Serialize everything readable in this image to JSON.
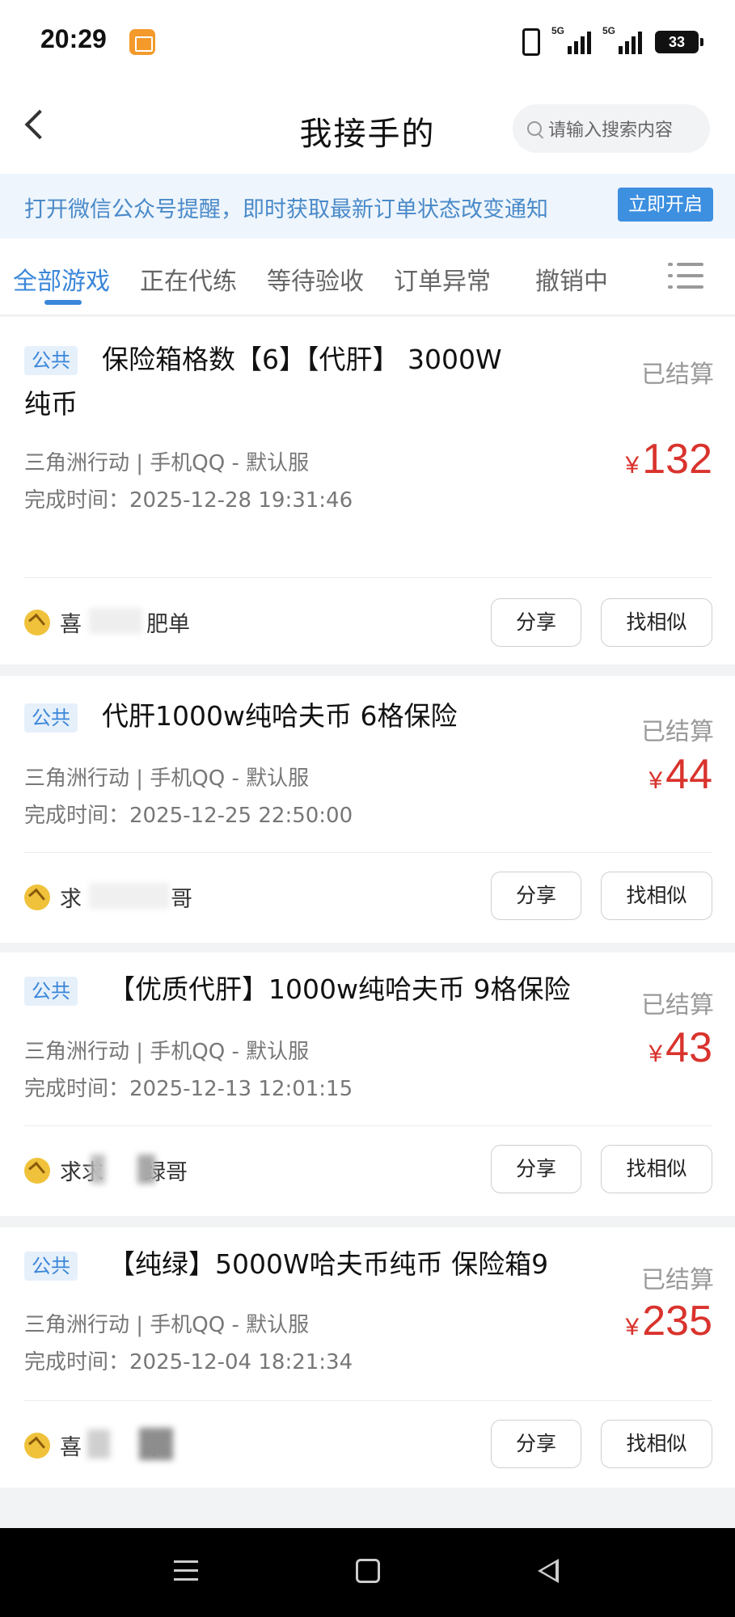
{
  "status_bar": {
    "time": "20:29",
    "network_1": "5G",
    "network_2": "5G",
    "battery": "33"
  },
  "header": {
    "title": "我接手的",
    "search_placeholder": "请输入搜索内容"
  },
  "notice": {
    "text": "打开微信公众号提醒，即时获取最新订单状态改变通知",
    "button": "立即开启"
  },
  "tabs": [
    {
      "label": "全部游戏",
      "active": true
    },
    {
      "label": "正在代练",
      "active": false
    },
    {
      "label": "等待验收",
      "active": false
    },
    {
      "label": "订单异常",
      "active": false
    },
    {
      "label": "撤销中",
      "active": false
    }
  ],
  "orders": [
    {
      "badge": "公共",
      "title_line1": "保险箱格数【6】【代肝】 3000W",
      "title_line2": "纯币",
      "status": "已结算",
      "game_info": "三角洲行动 | 手机QQ - 默认服",
      "finish_time": "完成时间：2025-12-28 19:31:46",
      "currency": "¥",
      "price": "132",
      "seller_start": "喜",
      "seller_end": "肥单",
      "share": "分享",
      "similar": "找相似"
    },
    {
      "badge": "公共",
      "title_line1": "代肝1000w纯哈夫币 6格保险",
      "status": "已结算",
      "game_info": "三角洲行动 | 手机QQ - 默认服",
      "finish_time": "完成时间：2025-12-25 22:50:00",
      "currency": "¥",
      "price": "44",
      "seller_start": "求",
      "seller_end": "哥",
      "share": "分享",
      "similar": "找相似"
    },
    {
      "badge": "公共",
      "title_line1": "【优质代肝】1000w纯哈夫币 9格保险",
      "status": "已结算",
      "game_info": "三角洲行动 | 手机QQ - 默认服",
      "finish_time": "完成时间：2025-12-13 12:01:15",
      "currency": "¥",
      "price": "43",
      "seller_start": "求求",
      "seller_end": "绿哥",
      "share": "分享",
      "similar": "找相似"
    },
    {
      "badge": "公共",
      "title_line1": "【纯绿】5000W哈夫币纯币 保险箱9",
      "status": "已结算",
      "game_info": "三角洲行动 | 手机QQ - 默认服",
      "finish_time": "完成时间：2025-12-04 18:21:34",
      "currency": "¥",
      "price": "235",
      "seller_start": "喜",
      "seller_end": "单",
      "share": "分享",
      "similar": "找相似"
    }
  ],
  "colors": {
    "accent": "#3a86d9",
    "price": "#d9332d",
    "notice_bg": "#eef5fc"
  }
}
